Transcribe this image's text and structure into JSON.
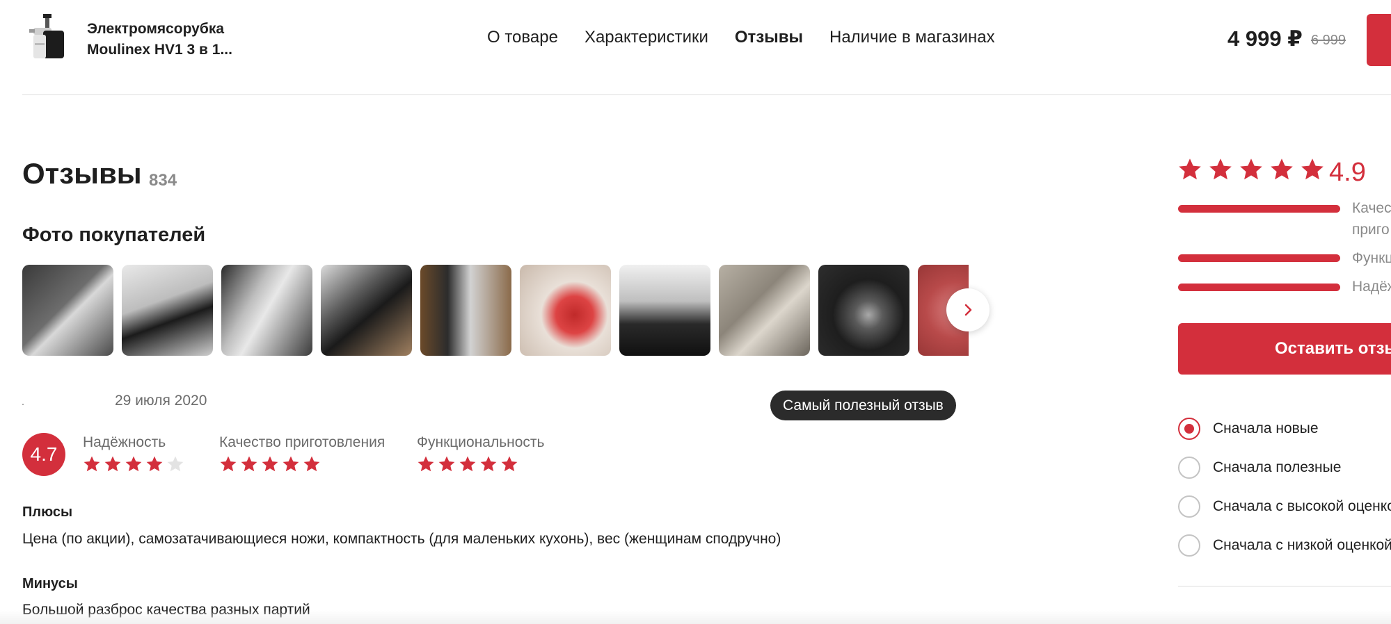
{
  "header": {
    "product_title_line1": "Электромясорубка",
    "product_title_line2": "Moulinex HV1 3 в 1...",
    "nav": [
      {
        "label": "О товаре",
        "active": false
      },
      {
        "label": "Характеристики",
        "active": false
      },
      {
        "label": "Отзывы",
        "active": true
      },
      {
        "label": "Наличие в магазинах",
        "active": false
      }
    ],
    "price": "4 999 ₽",
    "old_price": "6 999"
  },
  "reviews": {
    "title": "Отзывы",
    "count": "834",
    "photos_title": "Фото покупателей",
    "photo_icons": [
      "photo-1",
      "photo-2",
      "photo-3",
      "photo-4",
      "photo-5",
      "photo-6",
      "photo-7",
      "photo-8",
      "photo-9",
      "photo-10"
    ],
    "next_icon": "chevron-right-icon"
  },
  "review": {
    "date": "29 июля 2020",
    "badge": "Самый полезный отзыв",
    "score": "4.7",
    "criteria": [
      {
        "label": "Надёжность",
        "stars": 4
      },
      {
        "label": "Качество приготовления",
        "stars": 5
      },
      {
        "label": "Функциональность",
        "stars": 5
      }
    ],
    "pros_label": "Плюсы",
    "pros_text": "Цена (по акции), самозатачивающиеся ножи, компактность (для маленьких кухонь), вес (женщинам сподручно)",
    "cons_label": "Минусы",
    "cons_text": "Большой разброс качества разных партий"
  },
  "summary": {
    "rating": "4.9",
    "stars": 5,
    "bars": [
      {
        "label_line1": "Качес",
        "label_line2": "приго",
        "fill": 1.0
      },
      {
        "label_line1": "Функц",
        "fill": 1.0
      },
      {
        "label_line1": "Надёж",
        "fill": 1.0
      }
    ],
    "leave_review": "Оставить отзыв"
  },
  "sort": {
    "options": [
      {
        "label": "Сначала новые",
        "checked": true
      },
      {
        "label": "Сначала полезные",
        "checked": false
      },
      {
        "label": "Сначала с высокой оценкой",
        "checked": false
      },
      {
        "label": "Сначала с низкой оценкой",
        "checked": false
      }
    ]
  },
  "colors": {
    "accent": "#d32f3c",
    "text": "#1f1f1f",
    "muted": "#8a8a8a",
    "badge_bg": "#2b2b2b"
  }
}
